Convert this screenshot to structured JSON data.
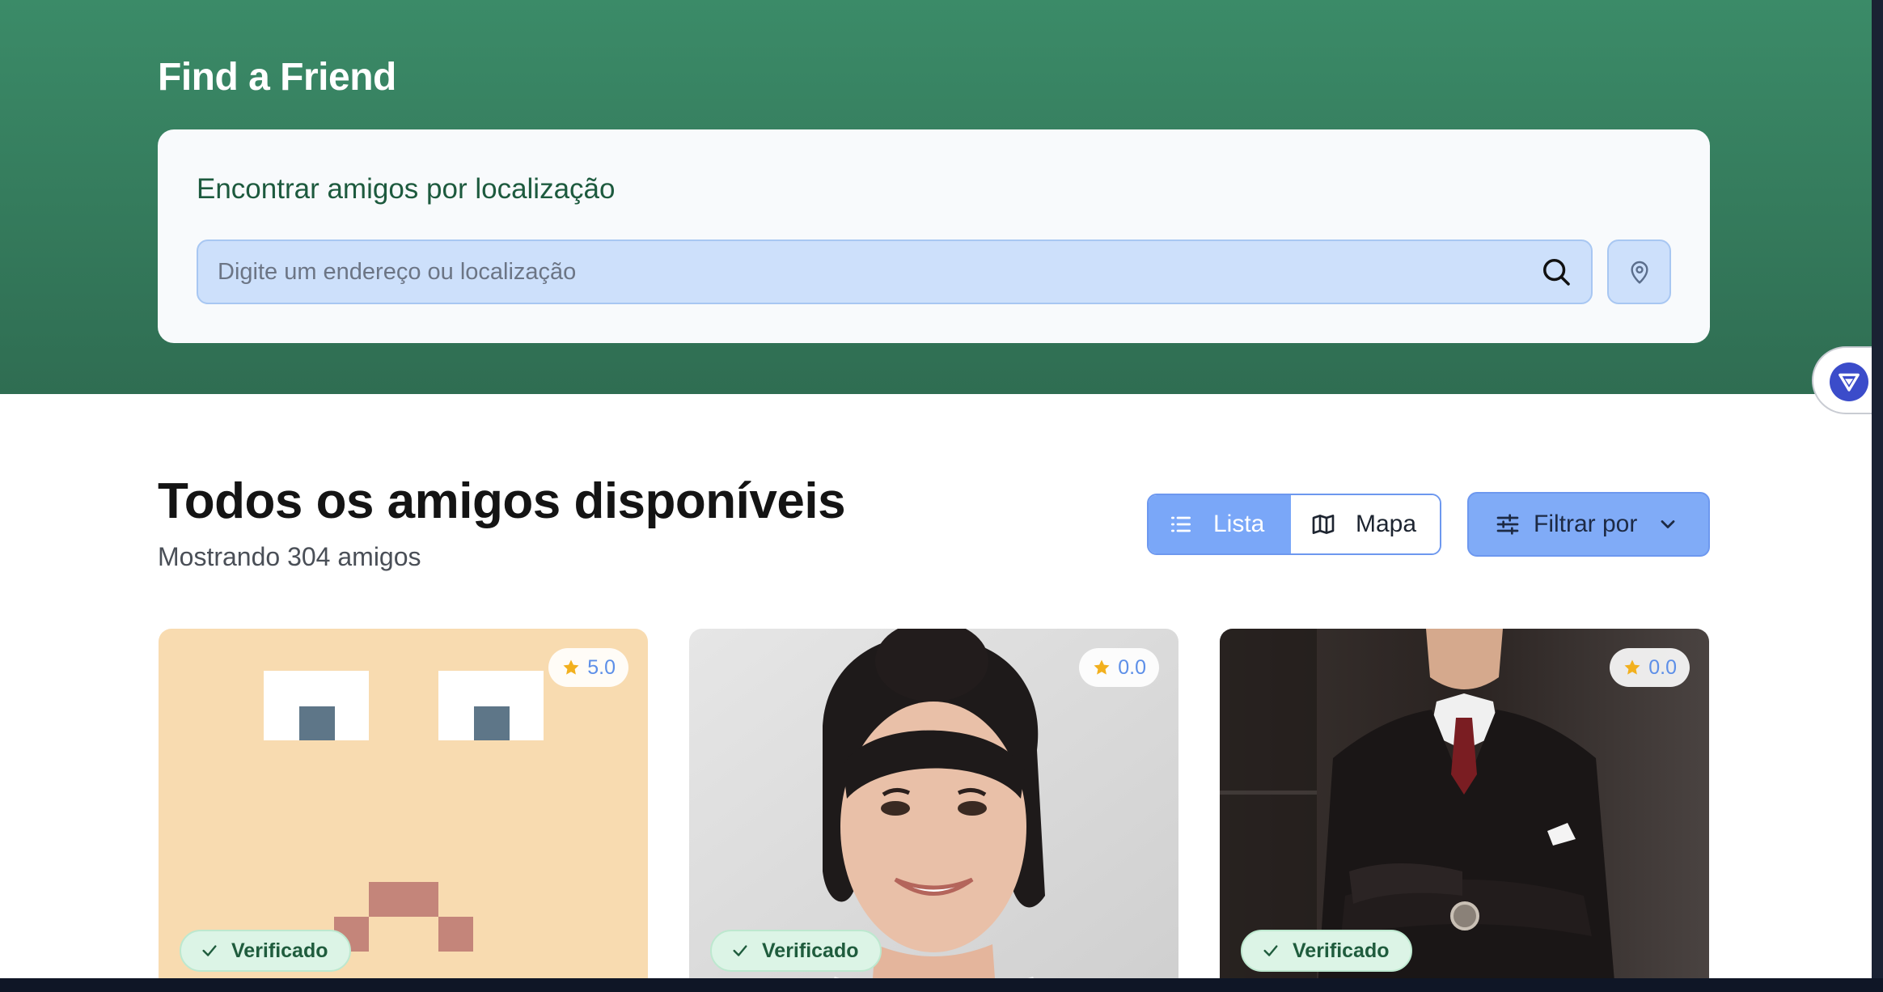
{
  "header": {
    "brand": "Find a Friend"
  },
  "search": {
    "title": "Encontrar amigos por localização",
    "placeholder": "Digite um endereço ou localização"
  },
  "section": {
    "title": "Todos os amigos disponíveis",
    "subtitle": "Mostrando 304 amigos"
  },
  "view_toggle": {
    "list_label": "Lista",
    "map_label": "Mapa",
    "active": "Lista"
  },
  "filter": {
    "label": "Filtrar por"
  },
  "cards": [
    {
      "rating": "5.0",
      "badge": "Verificado",
      "image": "pixel-avatar"
    },
    {
      "rating": "0.0",
      "badge": "Verificado",
      "image": "woman-portrait-photo"
    },
    {
      "rating": "0.0",
      "badge": "Verificado",
      "image": "man-in-suit-photo"
    }
  ],
  "colors": {
    "hero_top": "#3b8b68",
    "hero_bottom": "#2f6d52",
    "accent_blue": "#7aa7f8",
    "verified_bg": "#dcf4e6",
    "star": "#f2b01e"
  },
  "icons": [
    "search-icon",
    "map-pin-icon",
    "list-icon",
    "map-icon",
    "sliders-icon",
    "chevron-down-icon",
    "star-icon",
    "check-icon",
    "extension-logo-icon"
  ]
}
